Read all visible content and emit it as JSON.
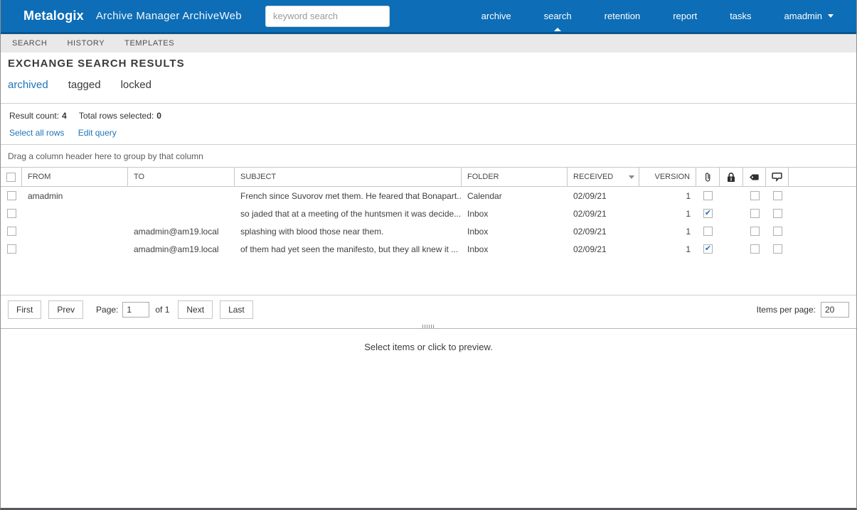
{
  "brand": {
    "logo": "Metalogix",
    "app_title": "Archive Manager ArchiveWeb",
    "search_placeholder": "keyword search"
  },
  "topnav": {
    "items": [
      {
        "label": "archive"
      },
      {
        "label": "search",
        "active": true
      },
      {
        "label": "retention"
      },
      {
        "label": "report"
      },
      {
        "label": "tasks"
      }
    ],
    "user_menu": "amadmin"
  },
  "subnav": {
    "items": [
      {
        "label": "SEARCH"
      },
      {
        "label": "HISTORY"
      },
      {
        "label": "TEMPLATES"
      }
    ]
  },
  "page": {
    "title": "EXCHANGE SEARCH RESULTS",
    "tabs": [
      {
        "label": "archived",
        "active": true
      },
      {
        "label": "tagged",
        "active": false
      },
      {
        "label": "locked",
        "active": false
      }
    ]
  },
  "results": {
    "count_label": "Result count:",
    "count_value": "4",
    "selected_label": "Total rows selected:",
    "selected_value": "0",
    "select_all_link": "Select all rows",
    "edit_query_link": "Edit query"
  },
  "grid": {
    "group_hint": "Drag a column header here to group by that column",
    "columns": {
      "from": "FROM",
      "to": "TO",
      "subject": "SUBJECT",
      "folder": "FOLDER",
      "received": "RECEIVED",
      "version": "VERSION"
    },
    "icon_columns": [
      "attachment",
      "lock",
      "tag",
      "comment"
    ],
    "rows": [
      {
        "from": "amadmin",
        "to": "",
        "subject": "French since Suvorov met them. He feared that Bonapart...",
        "folder": "Calendar",
        "received": "02/09/21",
        "version": "1",
        "attachment": false,
        "tag": false,
        "comment": false
      },
      {
        "from": "",
        "to": "",
        "subject": "so jaded that at a meeting of the huntsmen it was decide...",
        "folder": "Inbox",
        "received": "02/09/21",
        "version": "1",
        "attachment": true,
        "tag": false,
        "comment": false
      },
      {
        "from": "",
        "to": "amadmin@am19.local",
        "subject": "splashing with blood those near them.",
        "folder": "Inbox",
        "received": "02/09/21",
        "version": "1",
        "attachment": false,
        "tag": false,
        "comment": false
      },
      {
        "from": "",
        "to": "amadmin@am19.local",
        "subject": "of them had yet seen the manifesto, but they all knew it ...",
        "folder": "Inbox",
        "received": "02/09/21",
        "version": "1",
        "attachment": true,
        "tag": false,
        "comment": false
      }
    ]
  },
  "pagination": {
    "first": "First",
    "prev": "Prev",
    "page_label": "Page:",
    "page_value": "1",
    "of_label": "of 1",
    "next": "Next",
    "last": "Last",
    "items_per_page_label": "Items per page:",
    "items_per_page_value": "20"
  },
  "preview": {
    "hint": "Select items or click to preview."
  },
  "colors": {
    "brand_blue": "#0d6db6",
    "brand_blue_dark": "#09568d",
    "link_blue": "#1b75bb",
    "check_blue": "#1d74bc",
    "subnav_gray": "#e9e9e9",
    "border_gray": "#c6c6c6"
  }
}
